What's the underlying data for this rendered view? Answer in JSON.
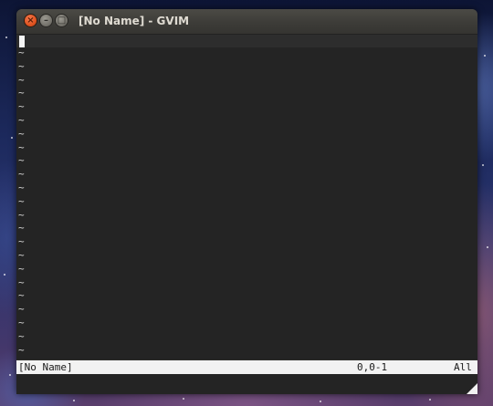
{
  "window": {
    "title": "[No Name] - GVIM",
    "buttons": {
      "close_glyph": "×",
      "minimize_glyph": "–",
      "maximize_glyph": "□"
    }
  },
  "editor": {
    "empty_line_marker": "~",
    "empty_line_count": 25
  },
  "statusline": {
    "file": "[No Name]",
    "position": "0,0-1",
    "scroll": "All"
  },
  "colors": {
    "editor_background": "#242424",
    "statusline_background": "#f2f2f2",
    "close_button": "#e05320"
  },
  "icons": {
    "close": "close-icon",
    "minimize": "minimize-icon",
    "maximize": "maximize-icon",
    "resize": "resize-grip-icon"
  }
}
